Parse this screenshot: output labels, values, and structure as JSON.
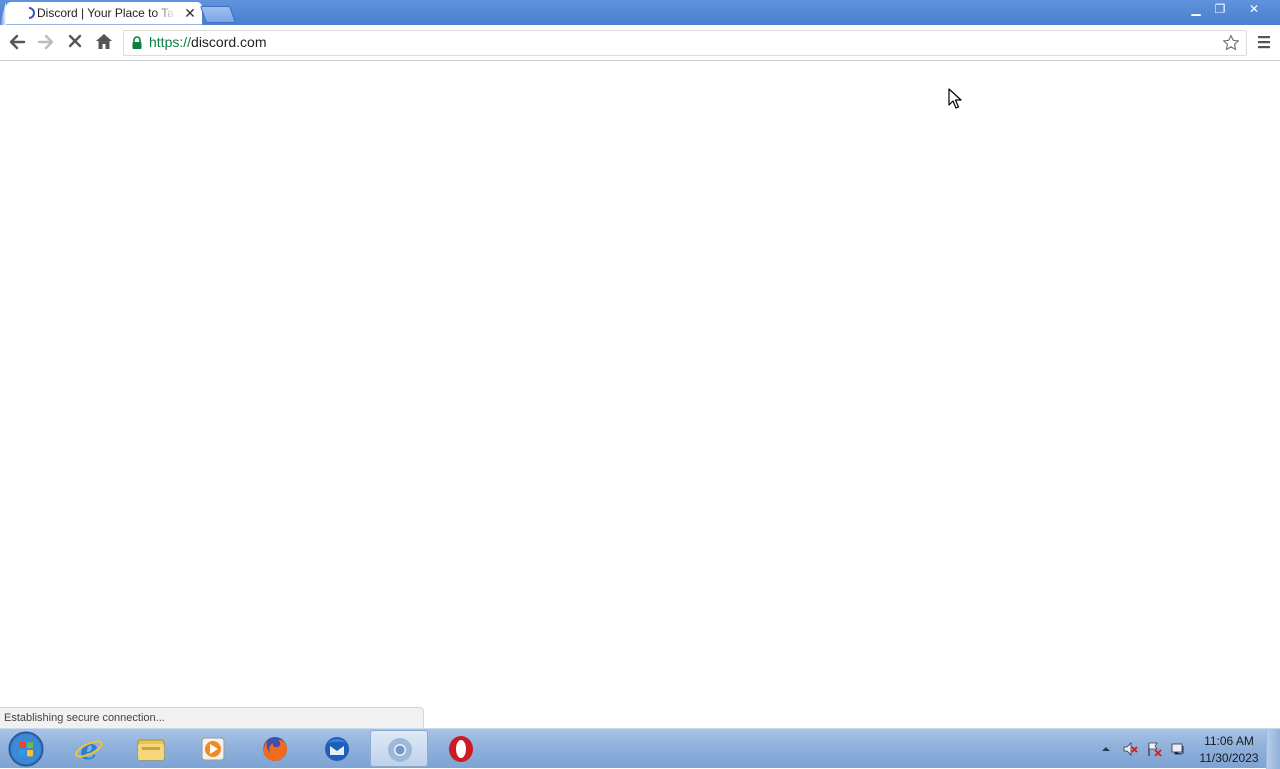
{
  "browser": {
    "tab": {
      "title": "Discord | Your Place to Talk and Hang Out",
      "close_glyph": "✕"
    },
    "window_controls": {
      "minimize_glyph": "▁",
      "maximize_glyph": "❐",
      "close_glyph": "✕"
    },
    "omnibox": {
      "scheme": "https://",
      "host": "discord.com"
    },
    "status": "Establishing secure connection..."
  },
  "taskbar": {
    "apps": [
      {
        "name": "internet-explorer",
        "active": false
      },
      {
        "name": "file-explorer",
        "active": false
      },
      {
        "name": "media-player",
        "active": false
      },
      {
        "name": "firefox",
        "active": false
      },
      {
        "name": "thunderbird",
        "active": false
      },
      {
        "name": "chrome",
        "active": true
      },
      {
        "name": "opera",
        "active": false
      }
    ],
    "clock": {
      "time": "11:06 AM",
      "date": "11/30/2023"
    }
  },
  "colors": {
    "titlebar": "#4a7fcf",
    "secure_scheme": "#0b8043",
    "taskbar": "#8fb1dc"
  }
}
